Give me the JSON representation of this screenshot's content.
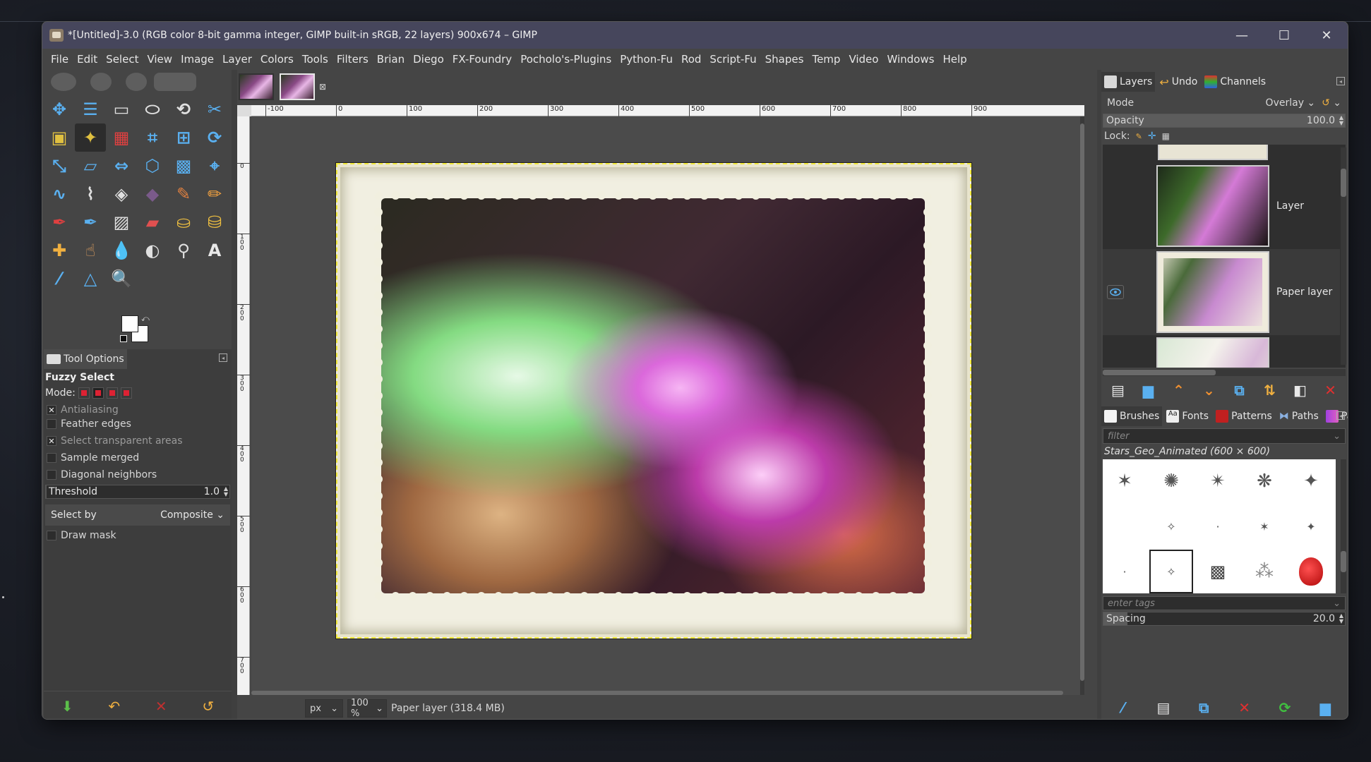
{
  "window": {
    "title": "*[Untitled]-3.0 (RGB color 8-bit gamma integer, GIMP built-in sRGB, 22 layers) 900x674 – GIMP",
    "minimize": "—",
    "maximize": "☐",
    "close": "✕"
  },
  "menu": [
    "File",
    "Edit",
    "Select",
    "View",
    "Image",
    "Layer",
    "Colors",
    "Tools",
    "Filters",
    "Brian",
    "Diego",
    "FX-Foundry",
    "Pocholo's-Plugins",
    "Python-Fu",
    "Rod",
    "Script-Fu",
    "Shapes",
    "Temp",
    "Video",
    "Windows",
    "Help"
  ],
  "tools": [
    {
      "name": "move-tool-icon",
      "glyph": "✥",
      "color": "#5ab0f0"
    },
    {
      "name": "align-tool-icon",
      "glyph": "☰",
      "color": "#5ab0f0"
    },
    {
      "name": "rect-select-icon",
      "glyph": "▭",
      "color": "#e0e0e0"
    },
    {
      "name": "ellipse-select-icon",
      "glyph": "⬭",
      "color": "#e0e0e0"
    },
    {
      "name": "free-select-icon",
      "glyph": "⟲",
      "color": "#e0e0e0"
    },
    {
      "name": "scissors-select-icon",
      "glyph": "✂",
      "color": "#5ab0f0"
    },
    {
      "name": "foreground-select-icon",
      "glyph": "▣",
      "color": "#e0c040"
    },
    {
      "name": "fuzzy-select-icon",
      "glyph": "✦",
      "color": "#e0c040"
    },
    {
      "name": "color-select-icon",
      "glyph": "▦",
      "color": "#e04040"
    },
    {
      "name": "crop-tool-icon",
      "glyph": "⌗",
      "color": "#5ab0f0"
    },
    {
      "name": "unified-transform-icon",
      "glyph": "⊞",
      "color": "#5ab0f0"
    },
    {
      "name": "rotate-tool-icon",
      "glyph": "⟳",
      "color": "#5ab0f0"
    },
    {
      "name": "scale-tool-icon",
      "glyph": "⤡",
      "color": "#5ab0f0"
    },
    {
      "name": "shear-tool-icon",
      "glyph": "▱",
      "color": "#5ab0f0"
    },
    {
      "name": "flip-tool-icon",
      "glyph": "⇔",
      "color": "#5ab0f0"
    },
    {
      "name": "perspective-tool-icon",
      "glyph": "⬡",
      "color": "#5ab0f0"
    },
    {
      "name": "cage-transform-icon",
      "glyph": "▩",
      "color": "#5ab0f0"
    },
    {
      "name": "handle-transform-icon",
      "glyph": "⌖",
      "color": "#5ab0f0"
    },
    {
      "name": "warp-transform-icon",
      "glyph": "∿",
      "color": "#5ab0f0"
    },
    {
      "name": "paths-tool-icon",
      "glyph": "⌇",
      "color": "#e0e0e0"
    },
    {
      "name": "bucket-fill-icon",
      "glyph": "◈",
      "color": "#e0e0e0"
    },
    {
      "name": "gradient-tool-icon",
      "glyph": "◆",
      "color": "#7a5a8a"
    },
    {
      "name": "paintbrush-icon",
      "glyph": "✎",
      "color": "#e08040"
    },
    {
      "name": "pencil-icon",
      "glyph": "✏",
      "color": "#f0a040"
    },
    {
      "name": "airbrush-icon",
      "glyph": "✒",
      "color": "#e04040"
    },
    {
      "name": "ink-tool-icon",
      "glyph": "✒",
      "color": "#5ab0f0"
    },
    {
      "name": "mypaint-brush-icon",
      "glyph": "▨",
      "color": "#e0e0e0"
    },
    {
      "name": "eraser-icon",
      "glyph": "▰",
      "color": "#e05050"
    },
    {
      "name": "clone-tool-icon",
      "glyph": "⛀",
      "color": "#f0c040"
    },
    {
      "name": "heal-tool-icon",
      "glyph": "⛁",
      "color": "#f0c040"
    },
    {
      "name": "perspective-clone-icon",
      "glyph": "✚",
      "color": "#f0b040"
    },
    {
      "name": "smudge-tool-icon",
      "glyph": "☝",
      "color": "#e0a060"
    },
    {
      "name": "blur-tool-icon",
      "glyph": "💧",
      "color": "#5ab0f0"
    },
    {
      "name": "dodge-burn-icon",
      "glyph": "◐",
      "color": "#e0e0e0"
    },
    {
      "name": "measure-tool-icon",
      "glyph": "⚲",
      "color": "#e0e0e0"
    },
    {
      "name": "text-tool-icon",
      "glyph": "A",
      "color": "#e8e8e8"
    },
    {
      "name": "color-picker-icon",
      "glyph": "⁄",
      "color": "#5ab0f0"
    },
    {
      "name": "measure-angle-icon",
      "glyph": "△",
      "color": "#5ab0f0"
    },
    {
      "name": "zoom-tool-icon",
      "glyph": "🔍",
      "color": "#5ab0f0"
    }
  ],
  "tool_options": {
    "tab_label": "Tool Options",
    "tool_name": "Fuzzy Select",
    "mode_label": "Mode:",
    "antialiasing": "Antialiasing",
    "feather_edges": "Feather edges",
    "select_transparent": "Select transparent areas",
    "sample_merged": "Sample merged",
    "diagonal_neighbors": "Diagonal neighbors",
    "threshold_label": "Threshold",
    "threshold_value": "1.0",
    "select_by_label": "Select by",
    "select_by_value": "Composite",
    "draw_mask": "Draw mask"
  },
  "rulers": {
    "h_labels": [
      "-100",
      "0",
      "100",
      "200",
      "300",
      "400",
      "500",
      "600",
      "700",
      "800",
      "900"
    ],
    "v_labels": [
      "0",
      "1\n0\n0",
      "2\n0\n0",
      "3\n0\n0",
      "4\n0\n0",
      "5\n0\n0",
      "6\n0\n0",
      "7\n0\n0"
    ]
  },
  "status": {
    "unit": "px",
    "zoom": "100 %",
    "message": "Paper layer (318.4 MB)"
  },
  "layers_dock": {
    "tabs": [
      "Layers",
      "Undo",
      "Channels"
    ],
    "mode_label": "Mode",
    "mode_value": "Overlay",
    "opacity_label": "Opacity",
    "opacity_value": "100.0",
    "lock_label": "Lock:",
    "layers": [
      {
        "name": "Layer"
      },
      {
        "name": "Paper layer"
      },
      {
        "name": ""
      }
    ]
  },
  "brushes_dock": {
    "tabs": [
      "Brushes",
      "Fonts",
      "Patterns",
      "Paths",
      "Palettes"
    ],
    "filter_placeholder": "filter",
    "brush_name": "Stars_Geo_Animated (600 × 600)",
    "tags_placeholder": "enter tags",
    "spacing_label": "Spacing",
    "spacing_value": "20.0"
  }
}
